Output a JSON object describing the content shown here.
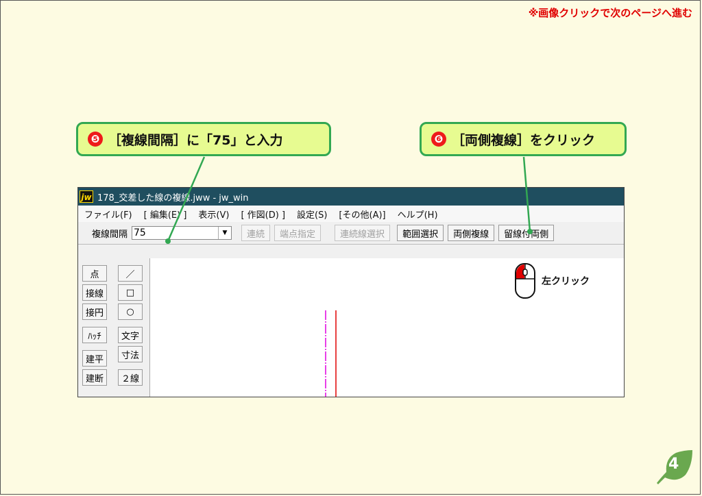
{
  "nav_note": "※画像クリックで次のページへ進む",
  "callouts": [
    {
      "num": "❺",
      "text": "［複線間隔］に「75」と入力"
    },
    {
      "num": "❻",
      "text": "［両側複線］をクリック"
    }
  ],
  "window": {
    "title": "178_交差した線の複線.jww - jw_win",
    "logo": "jw",
    "menu": [
      "ファイル(F)",
      "[ 編集(E) ]",
      "表示(V)",
      "[ 作図(D) ]",
      "設定(S)",
      "[その他(A)]",
      "ヘルプ(H)"
    ],
    "toolbar": {
      "label": "複線間隔",
      "input_value": "75",
      "buttons": [
        {
          "label": "連続",
          "enabled": false
        },
        {
          "label": "端点指定",
          "enabled": false
        },
        {
          "label": "連続線選択",
          "enabled": false
        },
        {
          "label": "範囲選択",
          "enabled": true
        },
        {
          "label": "両側複線",
          "enabled": true
        },
        {
          "label": "留線付両側",
          "enabled": true
        }
      ]
    },
    "left_tools": {
      "col1": [
        "点",
        "接線",
        "接円",
        "ﾊｯﾁ",
        "建平",
        "建断"
      ],
      "col2": [
        "／",
        "□",
        "○",
        "文字",
        "寸法",
        "２線"
      ]
    },
    "canvas_hint": "左クリック"
  },
  "page_number": "4",
  "colors": {
    "accent_red": "#e00000",
    "callout_fill": "#e7fb91",
    "callout_border": "#32a852",
    "titlebar": "#1f4e5f",
    "page_leaf": "#6aa84f"
  }
}
